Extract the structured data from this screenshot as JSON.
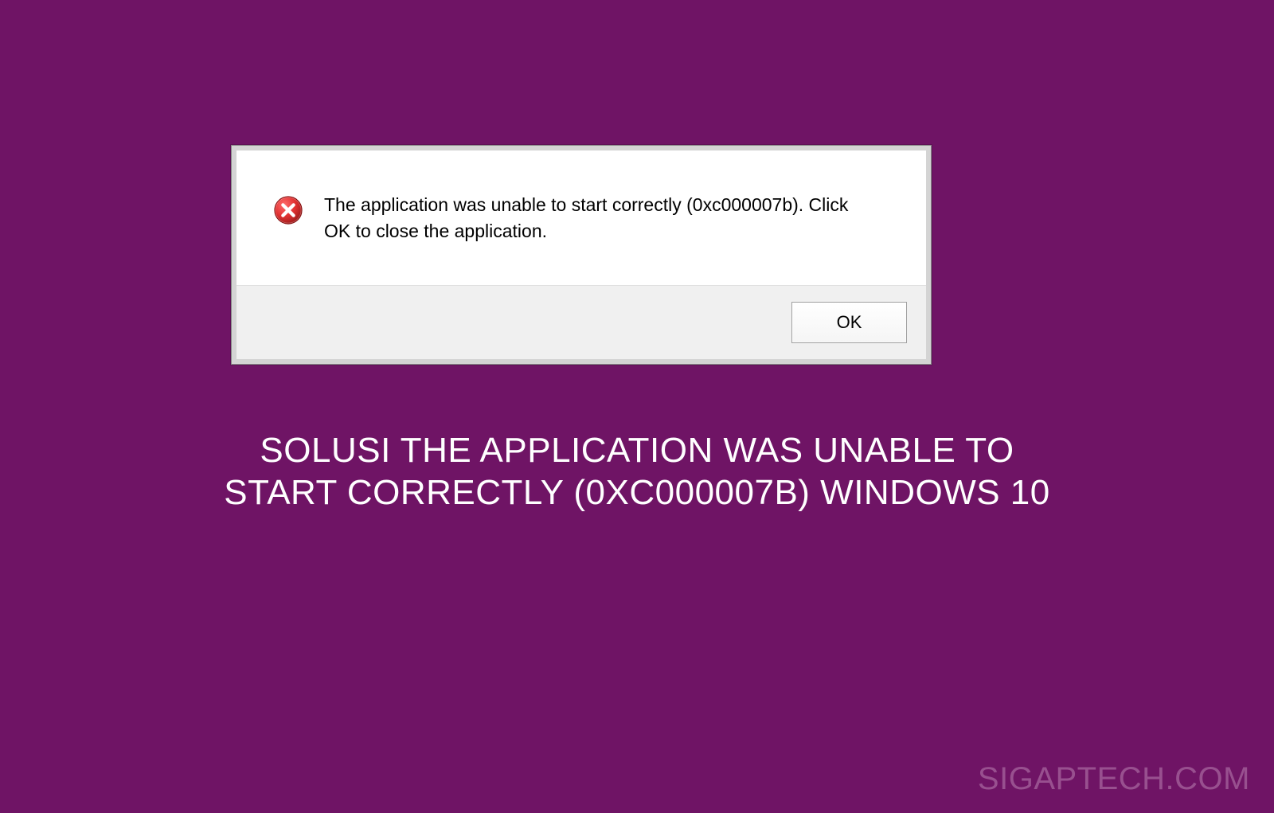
{
  "dialog": {
    "message": "The application was unable to start correctly (0xc000007b). Click OK to close the application.",
    "ok_label": "OK"
  },
  "headline": "SOLUSI THE APPLICATION WAS UNABLE TO START CORRECTLY (0XC000007B) WINDOWS 10",
  "watermark": "SIGAPTECH.COM"
}
